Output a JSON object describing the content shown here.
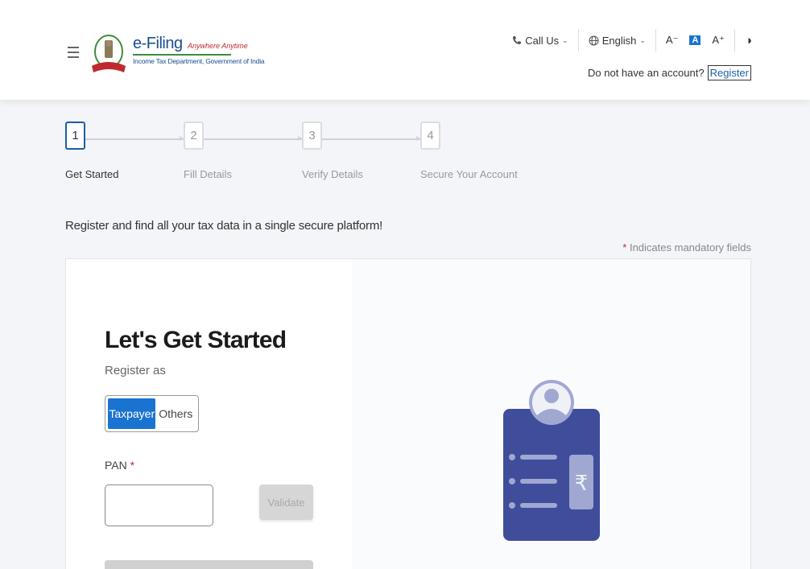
{
  "header": {
    "brand_title": "e-Filing",
    "brand_tagline": "Anywhere Anytime",
    "brand_subtitle": "Income Tax Department, Government of India",
    "call_us": "Call Us",
    "language": "English",
    "font_decrease": "A⁻",
    "font_default": "A",
    "font_increase": "A⁺",
    "contrast_icon": "◑",
    "account_prompt": "Do not have an account?",
    "register_link": "Register"
  },
  "stepper": {
    "steps": [
      {
        "number": "1",
        "label": "Get Started",
        "active": true
      },
      {
        "number": "2",
        "label": "Fill Details",
        "active": false
      },
      {
        "number": "3",
        "label": "Verify Details",
        "active": false
      },
      {
        "number": "4",
        "label": "Secure Your Account",
        "active": false
      }
    ]
  },
  "intro_text": "Register and find all your tax data in a single secure platform!",
  "mandatory_note": {
    "star": "*",
    "text": "Indicates mandatory fields"
  },
  "form": {
    "title": "Let's Get Started",
    "register_as_label": "Register as",
    "register_options": [
      {
        "label": "Taxpayer",
        "selected": true
      },
      {
        "label": "Others",
        "selected": false
      }
    ],
    "pan_label": "PAN",
    "pan_required_star": "*",
    "pan_value": "",
    "pan_placeholder": "",
    "validate_button": "Validate"
  },
  "colors": {
    "primary": "#1a73d0",
    "brand_blue": "#1a4d8f",
    "illustration_card": "#3f4d9b",
    "illustration_light": "#a0a8d2",
    "required": "#c0282d"
  }
}
